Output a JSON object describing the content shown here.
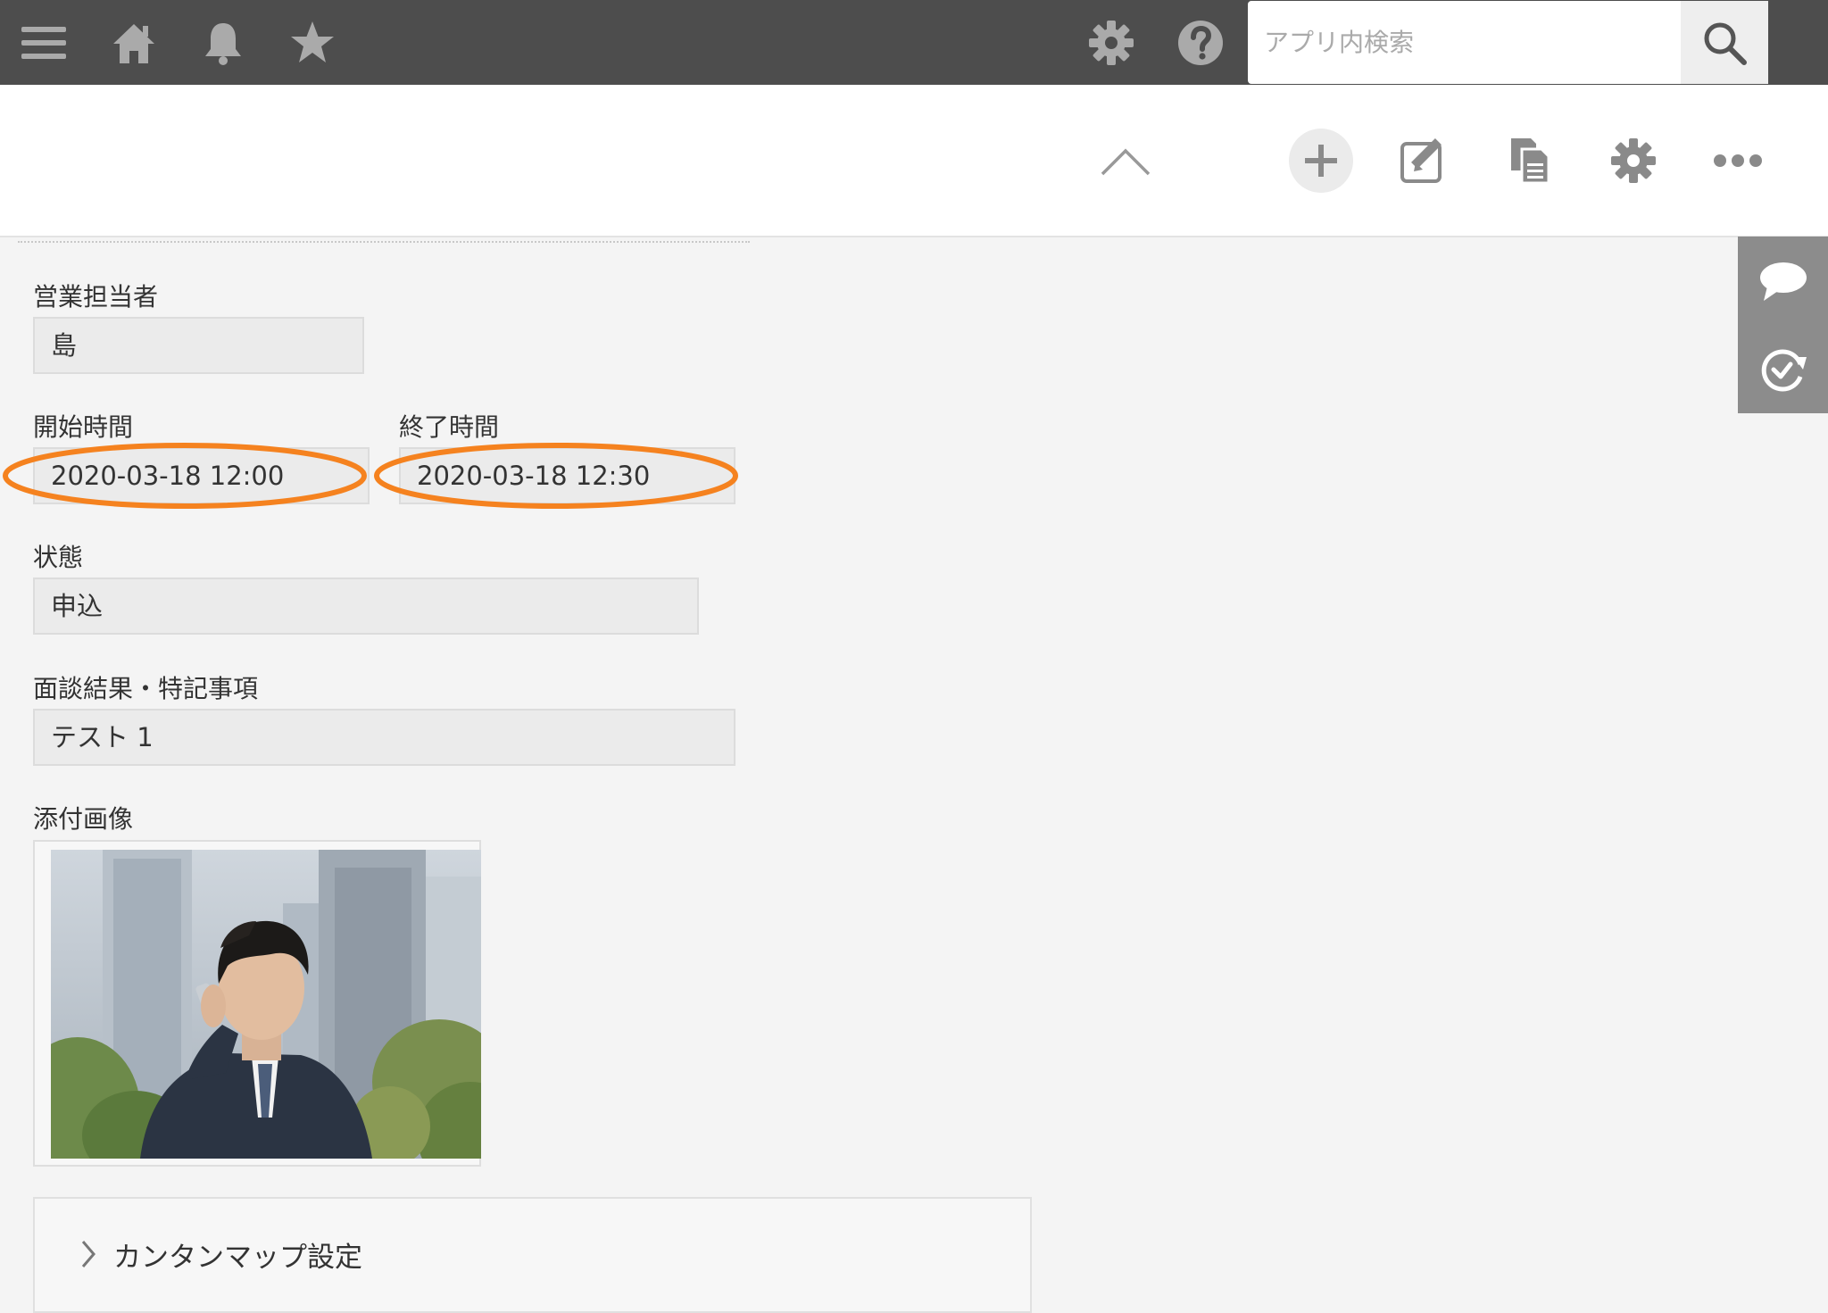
{
  "header": {
    "icons": [
      "menu-icon",
      "home-icon",
      "bell-icon",
      "star-icon",
      "gear-icon",
      "help-icon",
      "search-icon"
    ],
    "search_placeholder": "アプリ内検索"
  },
  "toolbar": {
    "icons": [
      "chevron-up-icon",
      "plus-icon",
      "edit-icon",
      "copy-icon",
      "gear-icon",
      "more-icon"
    ]
  },
  "side_panel": {
    "icons": [
      "comment-icon",
      "history-icon"
    ]
  },
  "record": {
    "sales_rep": {
      "label": "営業担当者",
      "value": "島"
    },
    "start_time": {
      "label": "開始時間",
      "value": "2020-03-18 12:00"
    },
    "end_time": {
      "label": "終了時間",
      "value": "2020-03-18 12:30"
    },
    "status": {
      "label": "状態",
      "value": "申込"
    },
    "notes": {
      "label": "面談結果・特記事項",
      "value": "テスト 1"
    },
    "attachment": {
      "label": "添付画像"
    },
    "map_section": {
      "label": "カンタンマップ設定"
    }
  },
  "colors": {
    "header_bg": "#4d4d4d",
    "highlight": "#f5821f",
    "page_bg": "#f4f4f4"
  }
}
